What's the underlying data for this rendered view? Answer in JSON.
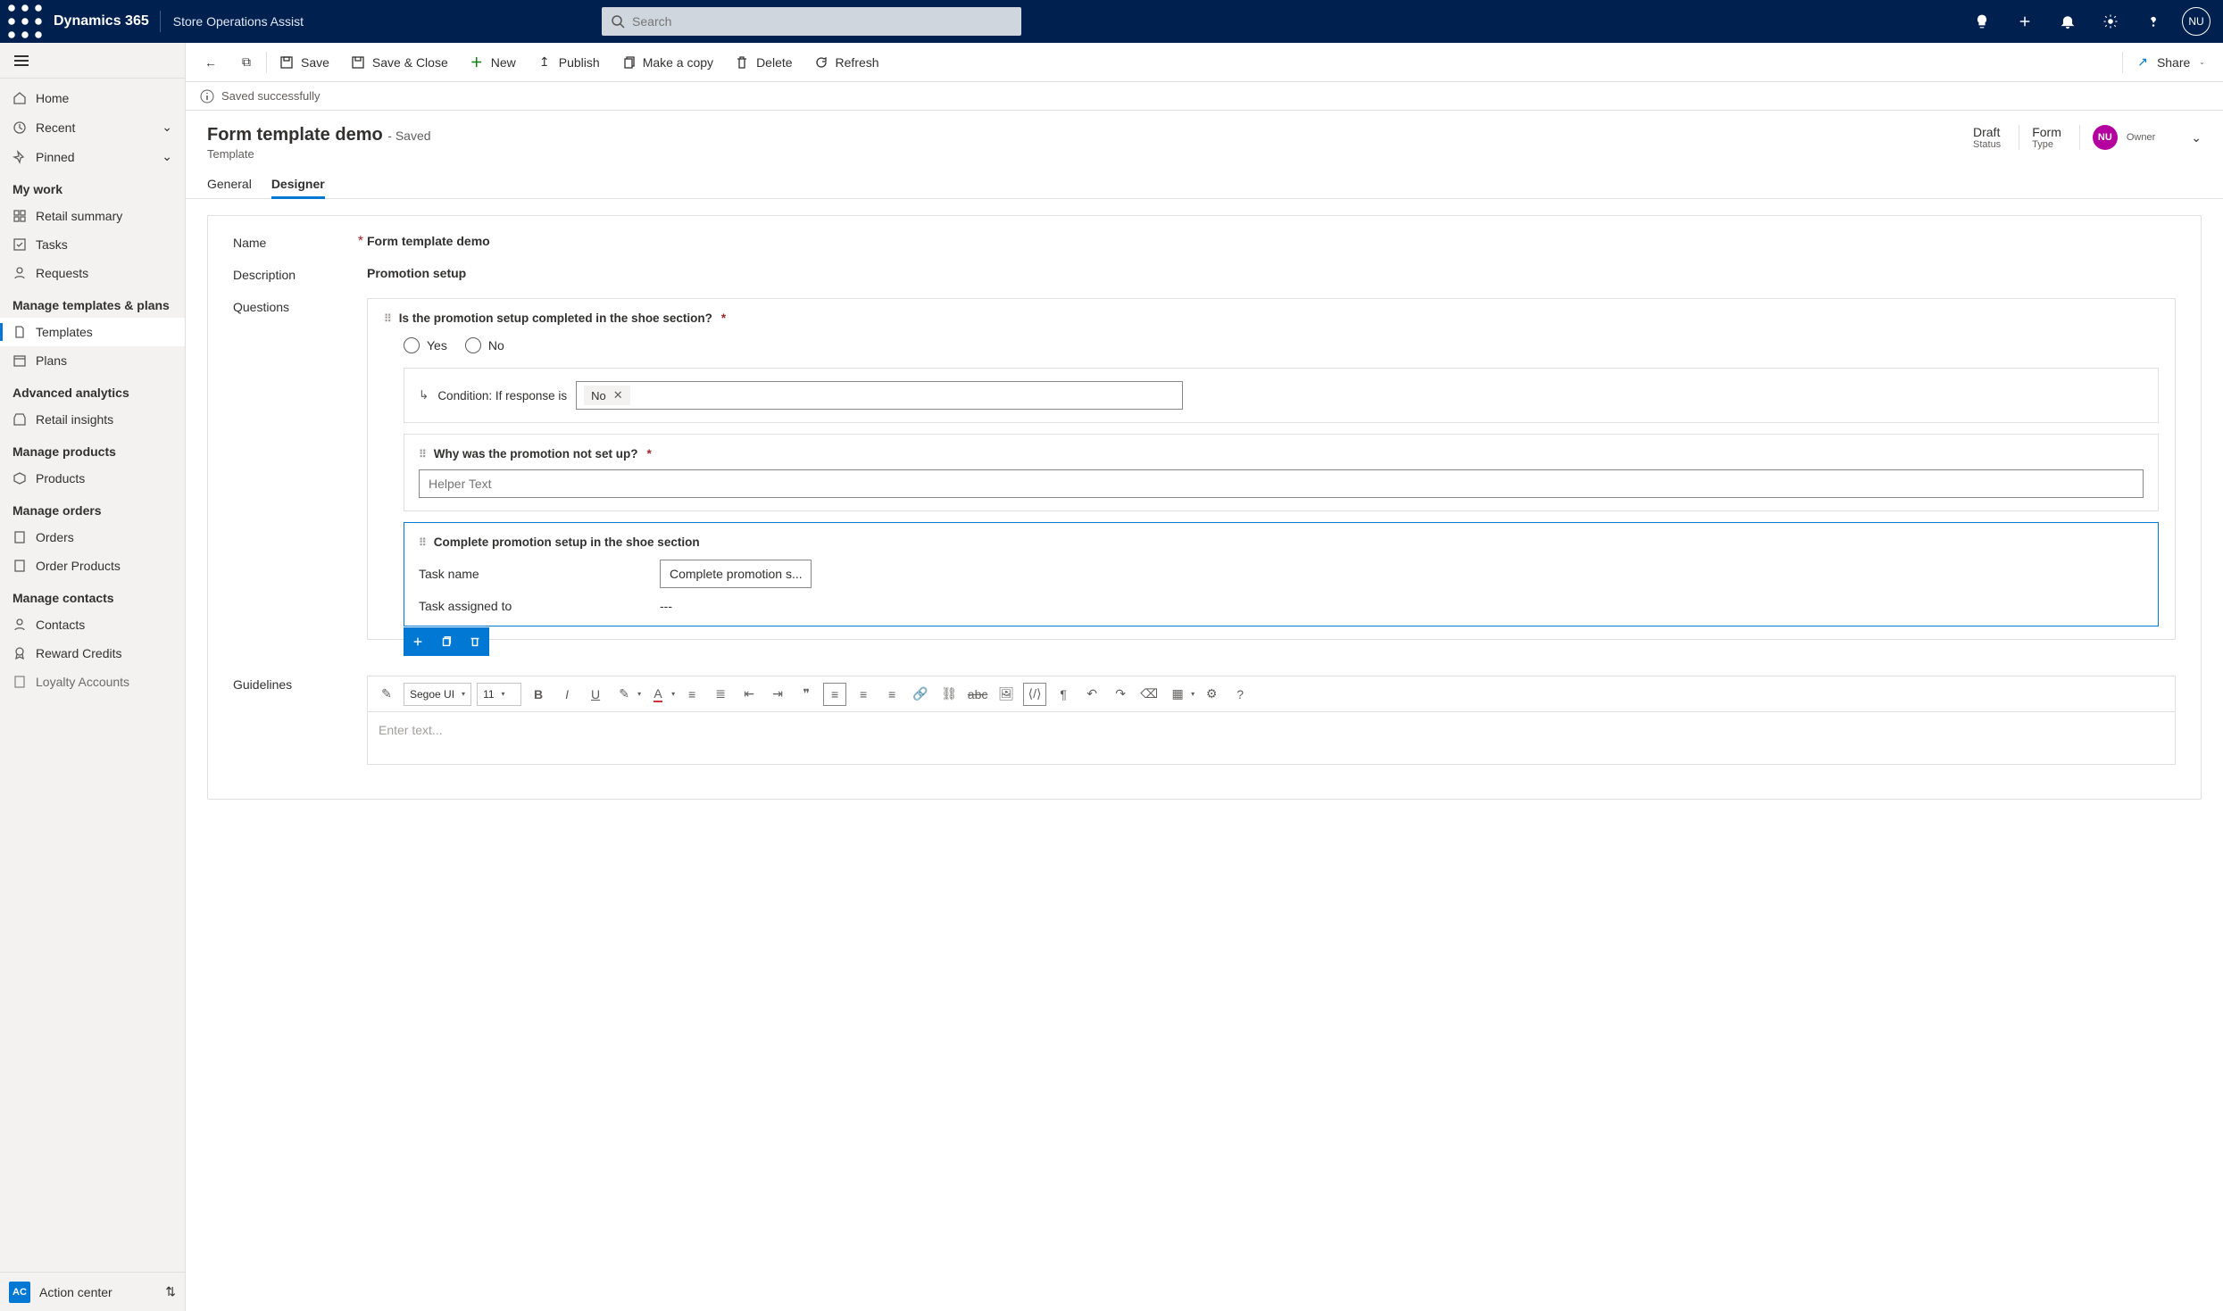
{
  "topbar": {
    "product": "Dynamics 365",
    "app": "Store Operations Assist",
    "search_placeholder": "Search",
    "user_initials": "NU"
  },
  "sidebar": {
    "quick": [
      {
        "label": "Home",
        "icon": "home"
      },
      {
        "label": "Recent",
        "icon": "clock",
        "expandable": true
      },
      {
        "label": "Pinned",
        "icon": "pin",
        "expandable": true
      }
    ],
    "groups": [
      {
        "header": "My work",
        "items": [
          {
            "label": "Retail summary",
            "icon": "grid"
          },
          {
            "label": "Tasks",
            "icon": "check"
          },
          {
            "label": "Requests",
            "icon": "person"
          }
        ]
      },
      {
        "header": "Manage templates & plans",
        "items": [
          {
            "label": "Templates",
            "icon": "doc",
            "selected": true
          },
          {
            "label": "Plans",
            "icon": "calendar"
          }
        ]
      },
      {
        "header": "Advanced analytics",
        "items": [
          {
            "label": "Retail insights",
            "icon": "store"
          }
        ]
      },
      {
        "header": "Manage products",
        "items": [
          {
            "label": "Products",
            "icon": "cube"
          }
        ]
      },
      {
        "header": "Manage orders",
        "items": [
          {
            "label": "Orders",
            "icon": "page"
          },
          {
            "label": "Order Products",
            "icon": "page"
          }
        ]
      },
      {
        "header": "Manage contacts",
        "items": [
          {
            "label": "Contacts",
            "icon": "person"
          },
          {
            "label": "Reward Credits",
            "icon": "badge"
          },
          {
            "label": "Loyalty Accounts",
            "icon": "page"
          }
        ]
      }
    ],
    "area_badge": "AC",
    "area_label": "Action center"
  },
  "cmdbar": {
    "items": [
      {
        "label": "Save",
        "icon": "save"
      },
      {
        "label": "Save & Close",
        "icon": "saveclose"
      },
      {
        "label": "New",
        "icon": "plus",
        "color": "#107c10"
      },
      {
        "label": "Publish",
        "icon": "upload"
      },
      {
        "label": "Make a copy",
        "icon": "copy"
      },
      {
        "label": "Delete",
        "icon": "trash"
      },
      {
        "label": "Refresh",
        "icon": "refresh"
      }
    ],
    "share": "Share"
  },
  "notification": "Saved successfully",
  "header": {
    "title": "Form template demo",
    "saved_suffix": "- Saved",
    "entity": "Template",
    "status_value": "Draft",
    "status_label": "Status",
    "type_value": "Form",
    "type_label": "Type",
    "owner_label": "Owner",
    "owner_initials": "NU"
  },
  "tabs": [
    "General",
    "Designer"
  ],
  "active_tab": "Designer",
  "form": {
    "name_label": "Name",
    "name_value": "Form template demo",
    "desc_label": "Description",
    "desc_value": "Promotion setup",
    "questions_label": "Questions",
    "guidelines_label": "Guidelines"
  },
  "question": {
    "text": "Is the promotion setup completed in the shoe section?",
    "options": [
      "Yes",
      "No"
    ],
    "condition_prefix": "Condition: If response is",
    "condition_value": "No",
    "sub_question": "Why was the promotion not set up?",
    "helper_placeholder": "Helper Text",
    "task_title": "Complete promotion setup in the shoe section",
    "task_name_label": "Task name",
    "task_name_value": "Complete promotion s...",
    "task_assigned_label": "Task assigned to",
    "task_assigned_value": "---"
  },
  "rte": {
    "font": "Segoe UI",
    "size": "11",
    "placeholder": "Enter text..."
  }
}
